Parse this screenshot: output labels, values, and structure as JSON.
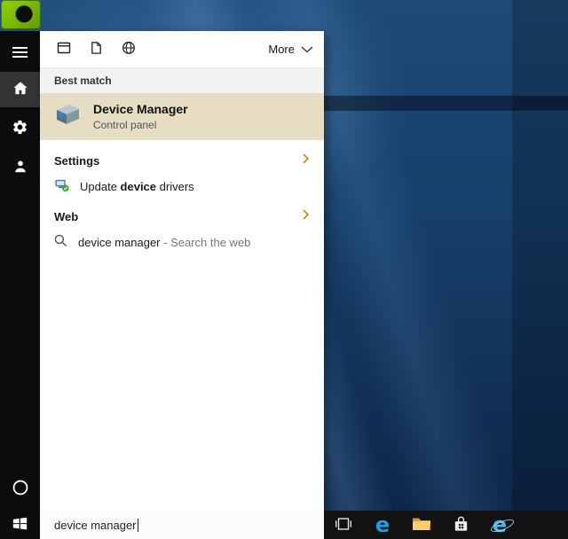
{
  "colors": {
    "best_match_highlight": "#e6ddc3",
    "section_chevron": "#c28a1e",
    "edge_blue": "#1ba1e2",
    "ie_blue": "#4db8ef",
    "folder_yellow": "#f7d06b",
    "shortcut_green": "#76b900",
    "sidebar_black": "#0c0c0c"
  },
  "panel": {
    "more_label": "More",
    "best_match_header": "Best match",
    "best_match": {
      "title": "Device Manager",
      "subtitle": "Control panel"
    },
    "settings": {
      "header": "Settings",
      "item": {
        "prefix": "Update ",
        "bold": "device",
        "suffix": " drivers"
      }
    },
    "web": {
      "header": "Web",
      "item": {
        "query": "device manager ",
        "suffix": "- Search the web"
      }
    }
  },
  "search_box": {
    "value": "device manager"
  },
  "taskbar": {
    "edge_glyph": "e",
    "ie_glyph": "e"
  },
  "icons": {
    "menu-icon": "hamburger bars",
    "home-icon": "house",
    "gear-icon": "settings gear",
    "feedback-icon": "person silhouette",
    "cortana-circle-icon": "circle outline",
    "windows-logo-icon": "four-pane window",
    "apps-filter-icon": "app window outline",
    "document-filter-icon": "document sheet",
    "globe-filter-icon": "globe",
    "chevron-down-icon": "wide chevron down",
    "chevron-right-icon": "orange chevron right",
    "device-manager-icon": "isometric device box",
    "driver-update-icon": "small monitor with update badge",
    "search-icon": "magnifier",
    "task-view-icon": "window with side panes",
    "edge-icon": "blue letter e",
    "folder-icon": "yellow folder",
    "store-icon": "white shopping bag",
    "ie-icon": "blue e with ring"
  }
}
